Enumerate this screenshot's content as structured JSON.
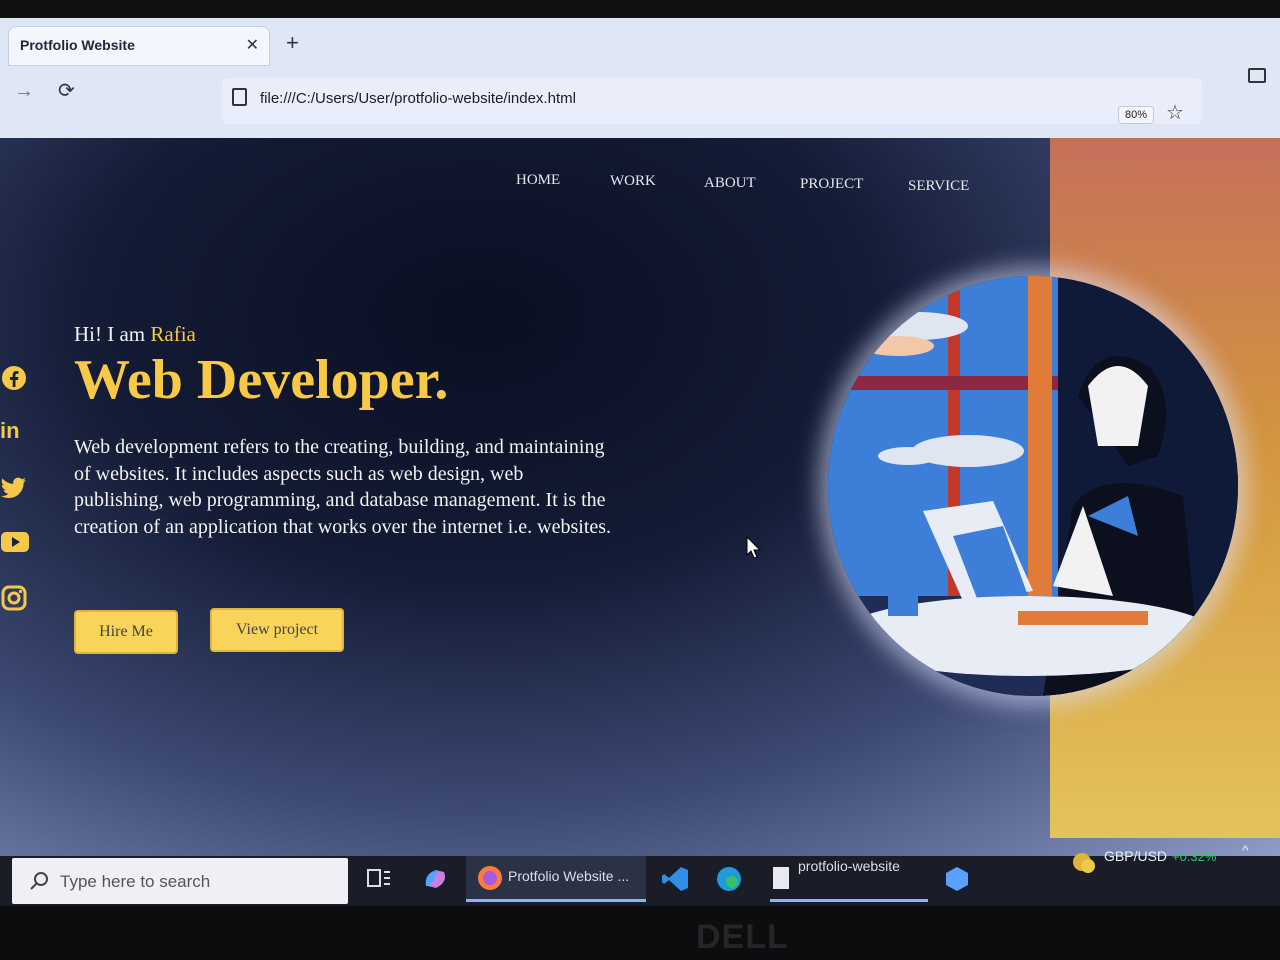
{
  "browser": {
    "tab_title": "Protfolio Website",
    "tab_close": "✕",
    "new_tab": "+",
    "url": "file:///C:/Users/User/protfolio-website/index.html",
    "zoom": "80%"
  },
  "site": {
    "nav": [
      "HOME",
      "WORK",
      "ABOUT",
      "PROJECT",
      "SERVICE"
    ],
    "greeting_prefix": "Hi! I am ",
    "greeting_name": "Rafia",
    "title": "Web Developer.",
    "description": "Web development refers to the creating, building, and maintaining of websites. It includes aspects such as web design, web publishing, web programming, and database management. It is the creation of an application that works over the internet i.e. websites.",
    "buttons": {
      "hire": "Hire Me",
      "view": "View project"
    },
    "social_icons": [
      "facebook-icon",
      "linkedin-icon",
      "twitter-icon",
      "youtube-icon",
      "instagram-icon"
    ],
    "linkedin_text": "in",
    "accent_color": "#f8c947"
  },
  "taskbar": {
    "search_placeholder": "Type here to search",
    "browser_app": "Protfolio Website ...",
    "folder_app": "protfolio-website",
    "ticker": "GBP/USD",
    "ticker_change": "+0.32%"
  },
  "hardware": {
    "brand": "DELL"
  }
}
